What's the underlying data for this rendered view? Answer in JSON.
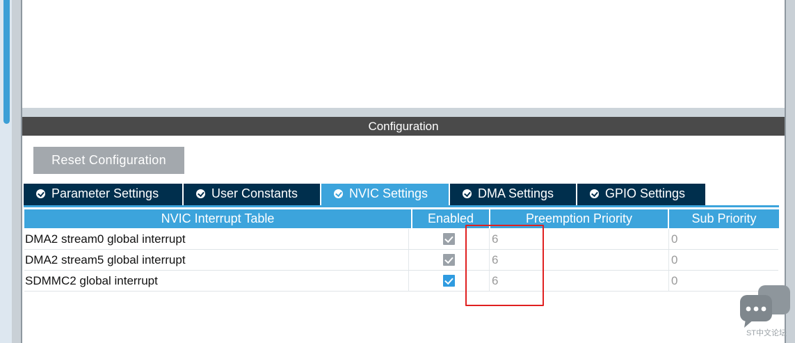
{
  "configuration": {
    "header_title": "Configuration",
    "reset_label": "Reset Configuration"
  },
  "tabs": [
    {
      "label": "Parameter Settings",
      "active": false
    },
    {
      "label": "User Constants",
      "active": false
    },
    {
      "label": "NVIC Settings",
      "active": true
    },
    {
      "label": "DMA Settings",
      "active": false
    },
    {
      "label": "GPIO Settings",
      "active": false
    }
  ],
  "table": {
    "columns": [
      "NVIC Interrupt Table",
      "Enabled",
      "Preemption Priority",
      "Sub Priority"
    ],
    "rows": [
      {
        "name": "DMA2 stream0 global interrupt",
        "enabled": true,
        "enabled_editable": false,
        "preemption": "6",
        "sub": "0"
      },
      {
        "name": "DMA2 stream5 global interrupt",
        "enabled": true,
        "enabled_editable": false,
        "preemption": "6",
        "sub": "0"
      },
      {
        "name": "SDMMC2 global interrupt",
        "enabled": true,
        "enabled_editable": true,
        "preemption": "6",
        "sub": "0"
      }
    ]
  },
  "watermark": {
    "text": "ST中文论坛",
    "icon": "chat-bubbles-icon"
  },
  "colors": {
    "tab_active": "#3ca4dc",
    "tab_inactive": "#002f4d",
    "header_dark": "#4a4a4a",
    "checkbox_gray": "#9aa1a8",
    "checkbox_blue": "#2f9be0",
    "highlight": "#e02020"
  }
}
